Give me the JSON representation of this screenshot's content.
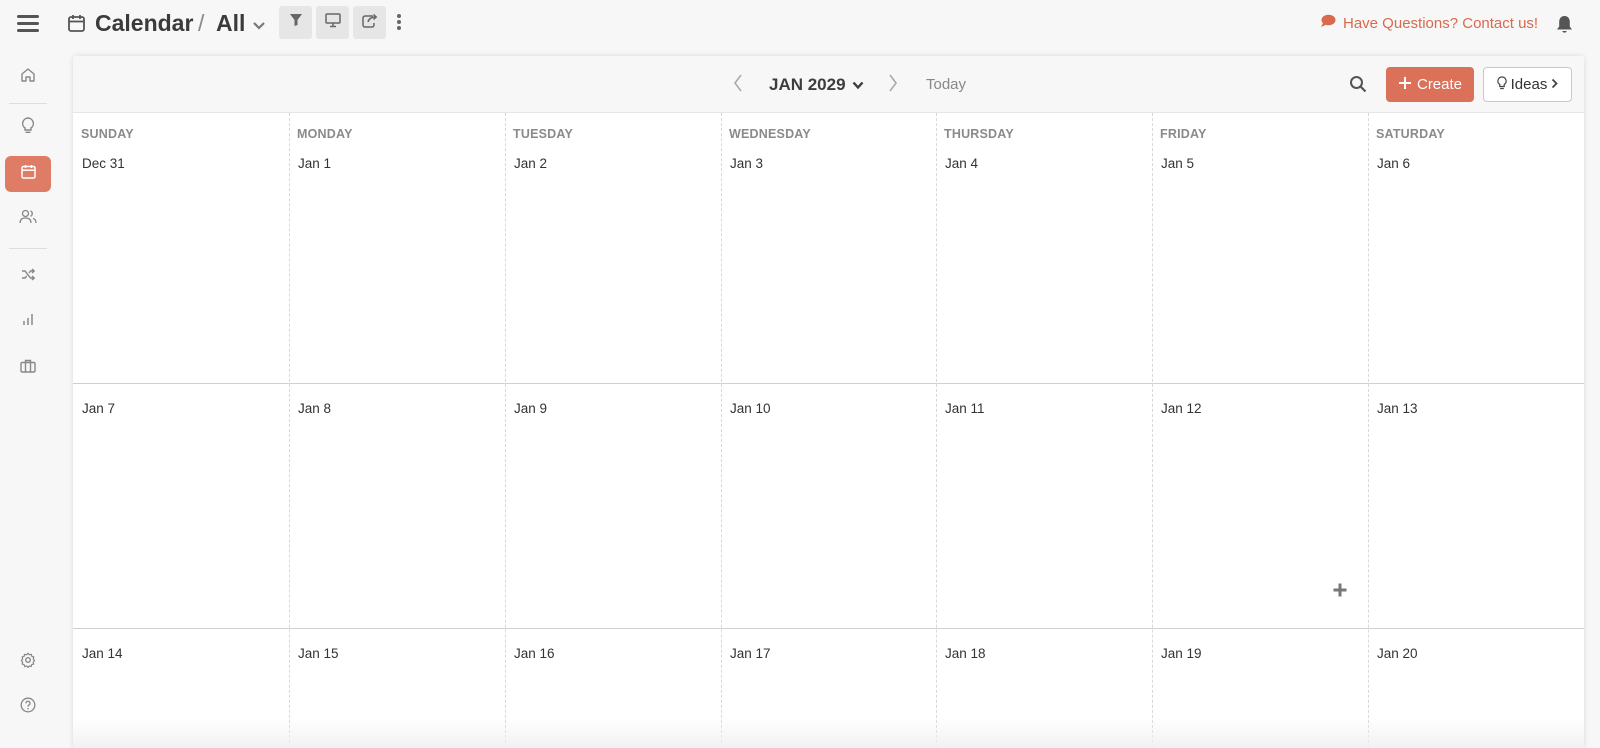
{
  "header": {
    "title": "Calendar",
    "separator": "/",
    "view": "All",
    "contact_text": "Have Questions? Contact us!",
    "accent_color": "#dc715a"
  },
  "toolbar": {
    "buttons": [
      "filter-icon",
      "monitor-icon",
      "share-icon"
    ]
  },
  "sidebar": {
    "items": [
      {
        "icon": "home-icon"
      },
      {
        "icon": "lightbulb-icon"
      },
      {
        "icon": "calendar-icon",
        "active": true
      },
      {
        "icon": "users-icon"
      },
      {
        "icon": "shuffle-icon"
      },
      {
        "icon": "bar-chart-icon"
      },
      {
        "icon": "briefcase-icon"
      },
      {
        "icon": "gear-icon"
      },
      {
        "icon": "help-icon"
      }
    ]
  },
  "calendar": {
    "month_label": "JAN 2029",
    "today_label": "Today",
    "create_label": "Create",
    "ideas_label": "Ideas",
    "weekdays": [
      "SUNDAY",
      "MONDAY",
      "TUESDAY",
      "WEDNESDAY",
      "THURSDAY",
      "FRIDAY",
      "SATURDAY"
    ],
    "weeks": [
      [
        "Dec 31",
        "Jan 1",
        "Jan 2",
        "Jan 3",
        "Jan 4",
        "Jan 5",
        "Jan 6"
      ],
      [
        "Jan 7",
        "Jan 8",
        "Jan 9",
        "Jan 10",
        "Jan 11",
        "Jan 12",
        "Jan 13"
      ],
      [
        "Jan 14",
        "Jan 15",
        "Jan 16",
        "Jan 17",
        "Jan 18",
        "Jan 19",
        "Jan 20"
      ]
    ]
  }
}
